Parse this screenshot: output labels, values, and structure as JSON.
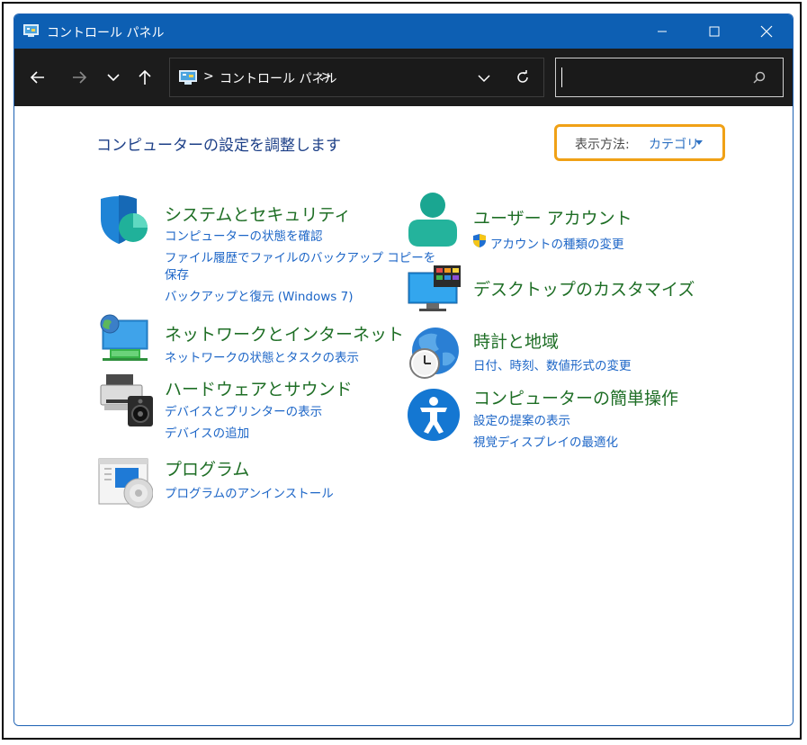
{
  "window": {
    "title": "コントロール パネル"
  },
  "address": {
    "path": "コントロール パネル",
    "separator": ">"
  },
  "search": {
    "value": "",
    "placeholder": ""
  },
  "main": {
    "heading": "コンピューターの設定を調整します",
    "view_by_label": "表示方法:",
    "view_by_value": "カテゴリ"
  },
  "categories": {
    "system": {
      "title": "システムとセキュリティ",
      "links": [
        "コンピューターの状態を確認",
        "ファイル履歴でファイルのバックアップ コピーを",
        "保存",
        "バックアップと復元 (Windows 7)"
      ]
    },
    "network": {
      "title": "ネットワークとインターネット",
      "links": [
        "ネットワークの状態とタスクの表示"
      ]
    },
    "hardware": {
      "title": "ハードウェアとサウンド",
      "links": [
        "デバイスとプリンターの表示",
        "デバイスの追加"
      ]
    },
    "programs": {
      "title": "プログラム",
      "links": [
        "プログラムのアンインストール"
      ]
    },
    "user": {
      "title": "ユーザー アカウント",
      "links": [
        "アカウントの種類の変更"
      ]
    },
    "appearance": {
      "title": "デスクトップのカスタマイズ",
      "links": []
    },
    "clock": {
      "title": "時計と地域",
      "links": [
        "日付、時刻、数値形式の変更"
      ]
    },
    "ease": {
      "title": "コンピューターの簡単操作",
      "links": [
        "設定の提案の表示",
        "視覚ディスプレイの最適化"
      ]
    }
  },
  "colors": {
    "titlebar": "#0d5fb3",
    "toolbar": "#1c1c1c",
    "category_title": "#1e6e25",
    "link": "#1d66c7",
    "heading": "#1c3f87",
    "highlight": "#f0a116"
  }
}
